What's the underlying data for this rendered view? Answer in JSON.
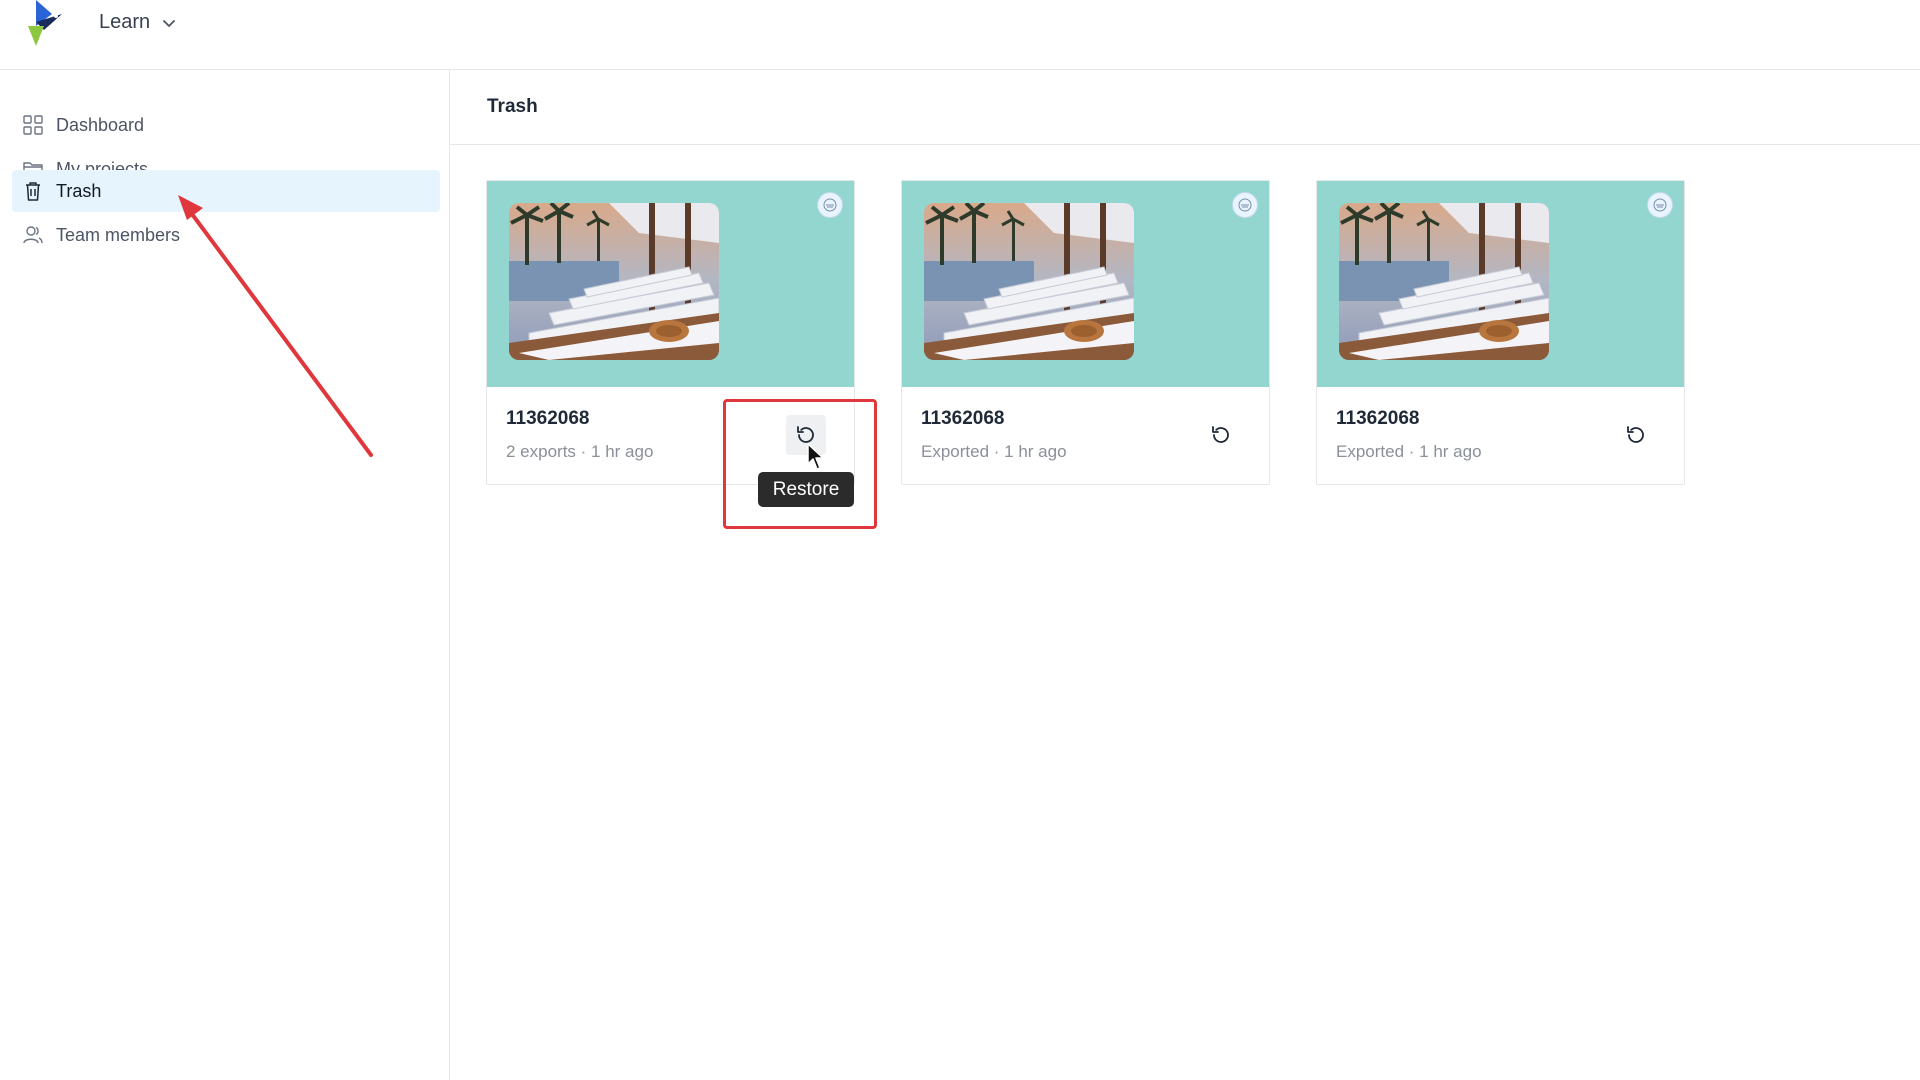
{
  "app": {
    "workspace_name": "Learn"
  },
  "sidebar": {
    "items": [
      {
        "label": "Dashboard",
        "icon": "grid-icon",
        "active": false
      },
      {
        "label": "My projects",
        "icon": "folder-icon",
        "active": false
      },
      {
        "label": "Trash",
        "icon": "trash-icon",
        "active": true
      },
      {
        "label": "Team members",
        "icon": "users-icon",
        "active": false
      }
    ]
  },
  "main": {
    "title": "Trash",
    "cards": [
      {
        "title": "11362068",
        "meta": "2 exports · 1 hr ago",
        "restore_icon": "restore-icon"
      },
      {
        "title": "11362068",
        "meta": "Exported · 1 hr ago",
        "restore_icon": "restore-icon"
      },
      {
        "title": "11362068",
        "meta": "Exported · 1 hr ago",
        "restore_icon": "restore-icon"
      }
    ],
    "tooltip": "Restore"
  },
  "colors": {
    "accent_active_bg": "#e6f4fd",
    "thumb_bg": "#93d6d0",
    "annotation_red": "#e0373d",
    "tooltip_bg": "#2b2b2b"
  }
}
